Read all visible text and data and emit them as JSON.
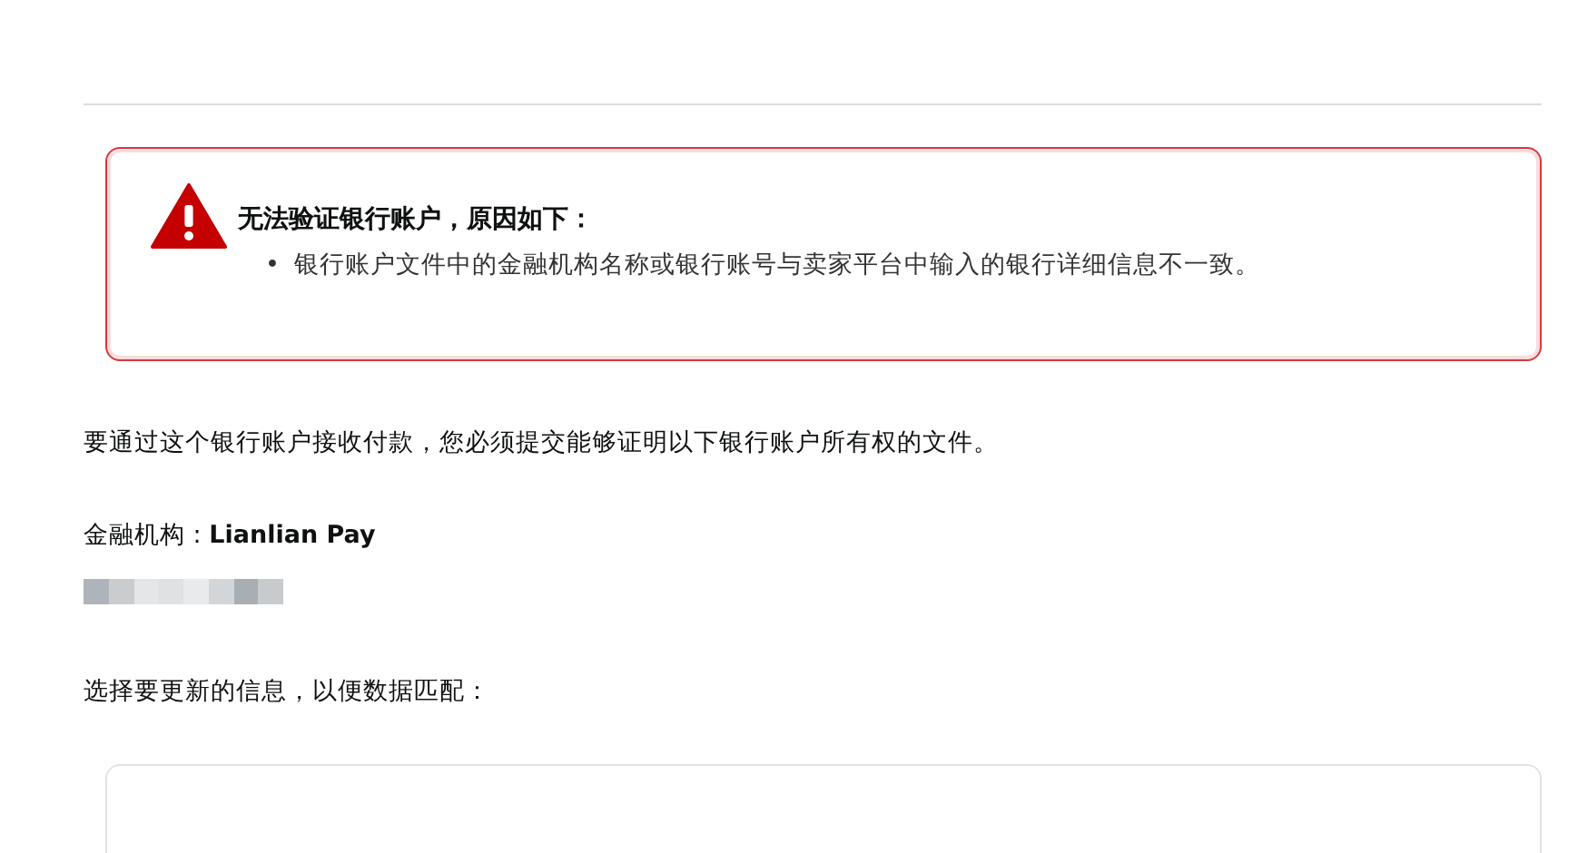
{
  "alert": {
    "kind": "error",
    "title": "无法验证银行账户，原因如下：",
    "reasons": [
      {
        "bullet": "•",
        "text": "银行账户文件中的金融机构名称或银行账号与卖家平台中输入的银行详细信息不一致。"
      }
    ]
  },
  "instruction": "要通过这个银行账户接收付款，您必须提交能够证明以下银行账户所有权的文件。",
  "institution": "金融机构 : **Lianlian Pay**",
  "update_prompt": "选择要更新的信息，以便数据匹配："
}
